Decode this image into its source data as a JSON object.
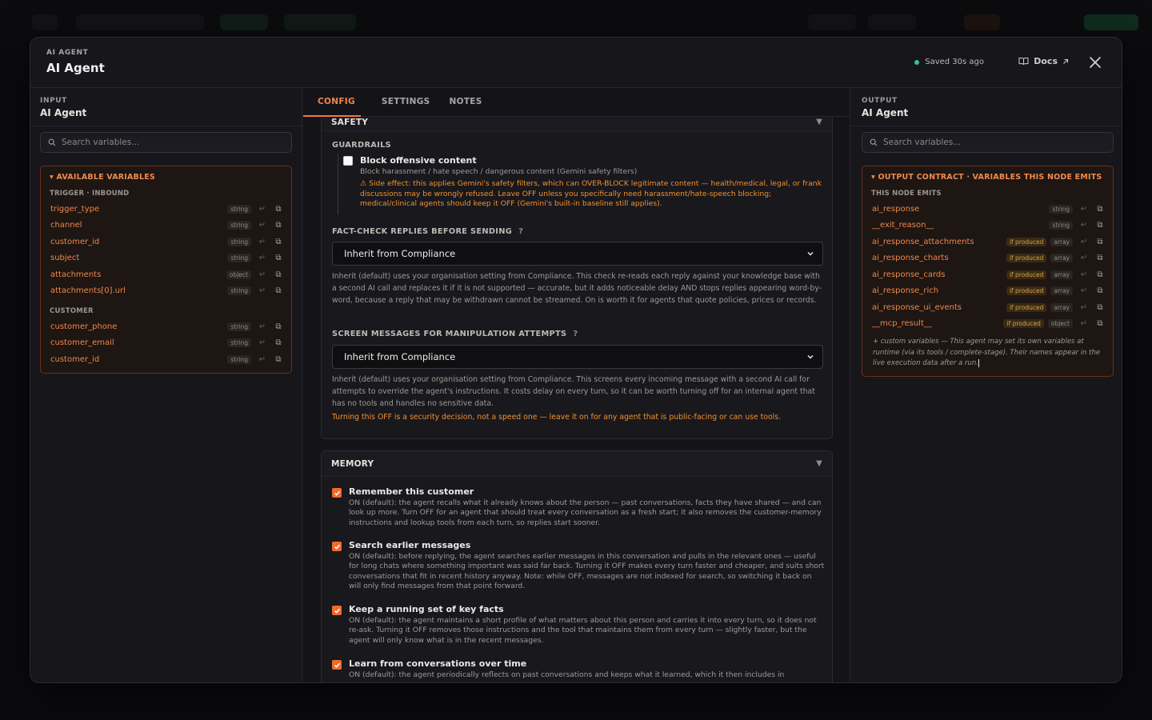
{
  "header": {
    "eyebrow": "AI AGENT",
    "title": "AI Agent",
    "saved": "Saved 30s ago",
    "docs_label": "Docs"
  },
  "input_panel": {
    "eyebrow": "INPUT",
    "title": "AI Agent",
    "search_placeholder": "Search variables...",
    "box_title": "AVAILABLE VARIABLES",
    "groups": [
      {
        "label": "TRIGGER · INBOUND",
        "vars": [
          {
            "name": "trigger_type",
            "type": "string"
          },
          {
            "name": "channel",
            "type": "string"
          },
          {
            "name": "customer_id",
            "type": "string"
          },
          {
            "name": "subject",
            "type": "string"
          },
          {
            "name": "attachments",
            "type": "object"
          },
          {
            "name": "attachments[0].url",
            "type": "string"
          }
        ]
      },
      {
        "label": "CUSTOMER",
        "vars": [
          {
            "name": "customer_phone",
            "type": "string"
          },
          {
            "name": "customer_email",
            "type": "string"
          },
          {
            "name": "customer_id",
            "type": "string"
          }
        ]
      }
    ]
  },
  "tabs": [
    {
      "label": "CONFIG"
    },
    {
      "label": "SETTINGS"
    },
    {
      "label": "NOTES"
    }
  ],
  "safety": {
    "title": "SAFETY",
    "guardrails_label": "GUARDRAILS",
    "block_title": "Block offensive content",
    "block_checked": false,
    "block_desc": "Block harassment / hate speech / dangerous content (Gemini safety filters)",
    "block_warning": "⚠ Side effect: this applies Gemini's safety filters, which can OVER-BLOCK legitimate content — health/medical, legal, or frank discussions may be wrongly refused. Leave OFF unless you specifically need harassment/hate-speech blocking; medical/clinical agents should keep it OFF (Gemini's built-in baseline still applies).",
    "factcheck_label": "FACT-CHECK REPLIES BEFORE SENDING",
    "factcheck_value": "Inherit from Compliance",
    "factcheck_desc": "Inherit (default) uses your organisation setting from Compliance. This check re-reads each reply against your knowledge base with a second AI call and replaces it if it is not supported — accurate, but it adds noticeable delay AND stops replies appearing word-by-word, because a reply that may be withdrawn cannot be streamed. On is worth it for agents that quote policies, prices or records.",
    "screen_label": "SCREEN MESSAGES FOR MANIPULATION ATTEMPTS",
    "screen_value": "Inherit from Compliance",
    "screen_desc": "Inherit (default) uses your organisation setting from Compliance. This screens every incoming message with a second AI call for attempts to override the agent's instructions. It costs delay on every turn, so it can be worth turning off for an internal agent that has no tools and handles no sensitive data.",
    "screen_warning": "Turning this OFF is a security decision, not a speed one — leave it on for any agent that is public-facing or can use tools.",
    "help_glyph": "?"
  },
  "memory": {
    "title": "MEMORY",
    "options": [
      {
        "title": "Remember this customer",
        "checked": true,
        "desc": "ON (default): the agent recalls what it already knows about the person — past conversations, facts they have shared — and can look up more. Turn OFF for an agent that should treat every conversation as a fresh start; it also removes the customer-memory instructions and lookup tools from each turn, so replies start sooner."
      },
      {
        "title": "Search earlier messages",
        "checked": true,
        "desc": "ON (default): before replying, the agent searches earlier messages in this conversation and pulls in the relevant ones — useful for long chats where something important was said far back. Turning it OFF makes every turn faster and cheaper, and suits short conversations that fit in recent history anyway. Note: while OFF, messages are not indexed for search, so switching it back on will only find messages from that point forward."
      },
      {
        "title": "Keep a running set of key facts",
        "checked": true,
        "desc": "ON (default): the agent maintains a short profile of what matters about this person and carries it into every turn, so it does not re-ask. Turning it OFF removes those instructions and the tool that maintains them from every turn — slightly faster, but the agent will only know what is in the recent messages."
      },
      {
        "title": "Learn from conversations over time",
        "checked": true,
        "desc": "ON (default): the agent periodically reflects on past conversations and keeps what it learned, which it then includes in"
      }
    ]
  },
  "output_panel": {
    "eyebrow": "OUTPUT",
    "title": "AI Agent",
    "search_placeholder": "Search variables...",
    "box_title": "OUTPUT CONTRACT · VARIABLES THIS NODE EMITS",
    "group_label": "THIS NODE EMITS",
    "vars": [
      {
        "name": "ai_response",
        "produced": "",
        "type": "string"
      },
      {
        "name": "__exit_reason__",
        "produced": "",
        "type": "string"
      },
      {
        "name": "ai_response_attachments",
        "produced": "if produced",
        "type": "array"
      },
      {
        "name": "ai_response_charts",
        "produced": "if produced",
        "type": "array"
      },
      {
        "name": "ai_response_cards",
        "produced": "if produced",
        "type": "array"
      },
      {
        "name": "ai_response_rich",
        "produced": "if produced",
        "type": "array"
      },
      {
        "name": "ai_response_ui_events",
        "produced": "if produced",
        "type": "array"
      },
      {
        "name": "__mcp_result__",
        "produced": "if produced",
        "type": "object"
      }
    ],
    "footnote": "+ custom variables — This agent may set its own variables at runtime (via its tools / complete-stage). Their names appear in the live execution data after a run."
  },
  "colors": {
    "accent": "#f0874a",
    "saved_dot": "#36c19a",
    "warning": "#f3912e"
  }
}
